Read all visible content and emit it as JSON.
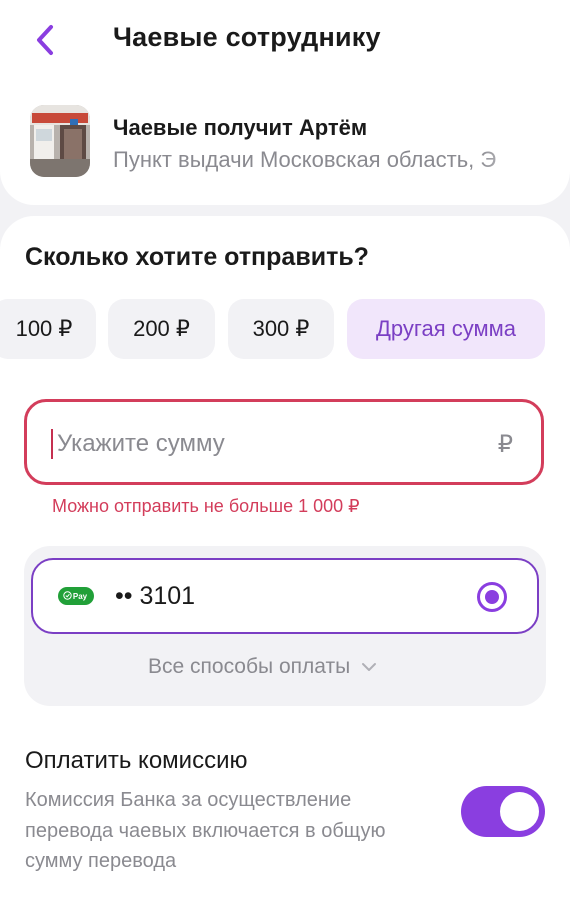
{
  "header": {
    "title": "Чаевые сотруднику",
    "back_icon": "chevron-left-icon"
  },
  "recipient": {
    "title": "Чаевые получит Артём",
    "subtitle": "Пункт выдачи Московская область, Э"
  },
  "amount_section": {
    "question": "Сколько хотите отправить?",
    "chips": [
      "100 ₽",
      "200 ₽",
      "300 ₽",
      "Другая сумма"
    ],
    "selected_chip": "Другая сумма",
    "input_placeholder": "Укажите сумму",
    "input_value": "",
    "currency_symbol": "₽",
    "error": "Можно отправить не больше 1 000 ₽"
  },
  "payment": {
    "badge_label": "Pay",
    "card_mask": "•• 3101",
    "selected": true,
    "all_methods_label": "Все способы оплаты",
    "all_methods_icon": "chevron-down-icon"
  },
  "fee": {
    "title": "Оплатить комиссию",
    "description": "Комиссия Банка за осуществление перевода чаевых включается в общую сумму перевода",
    "enabled": true
  },
  "colors": {
    "accent": "#8a3ee0",
    "error": "#d33d5b",
    "secondary_text": "#8a8a90",
    "chip_bg": "#f2f2f5",
    "selected_chip_bg": "#f1e6fb",
    "pay_badge": "#21a038"
  }
}
